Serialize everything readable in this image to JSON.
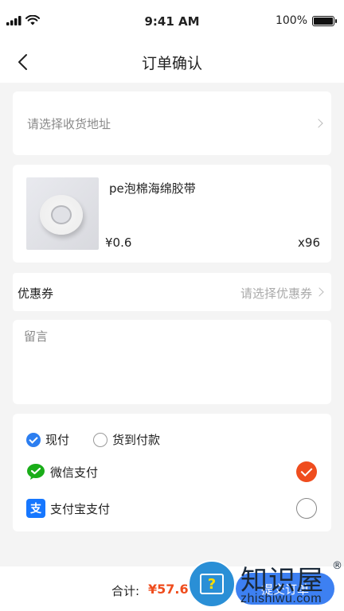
{
  "status_bar": {
    "time": "9:41 AM",
    "battery": "100%"
  },
  "nav": {
    "title": "订单确认"
  },
  "address": {
    "placeholder": "请选择收货地址"
  },
  "product": {
    "name": "pe泡棉海绵胶带",
    "price": "¥0.6",
    "quantity": "x96"
  },
  "coupon": {
    "label": "优惠券",
    "placeholder": "请选择优惠券"
  },
  "message": {
    "placeholder": "留言"
  },
  "payment": {
    "types": [
      {
        "label": "现付",
        "selected": true
      },
      {
        "label": "货到付款",
        "selected": false
      }
    ],
    "methods": [
      {
        "label": "微信支付",
        "selected": true,
        "icon": "wechat-icon"
      },
      {
        "label": "支付宝支付",
        "selected": false,
        "icon": "alipay-icon"
      }
    ]
  },
  "footer": {
    "total_label": "合计:",
    "total_value": "¥57.6",
    "submit_label": "提交订单"
  },
  "watermark": {
    "brand": "知识屋",
    "reg": "®",
    "url": "zhishiwu.com"
  },
  "colors": {
    "accent_blue": "#3d80f2",
    "accent_red": "#ef4d1e",
    "wechat_green": "#1aad19"
  }
}
